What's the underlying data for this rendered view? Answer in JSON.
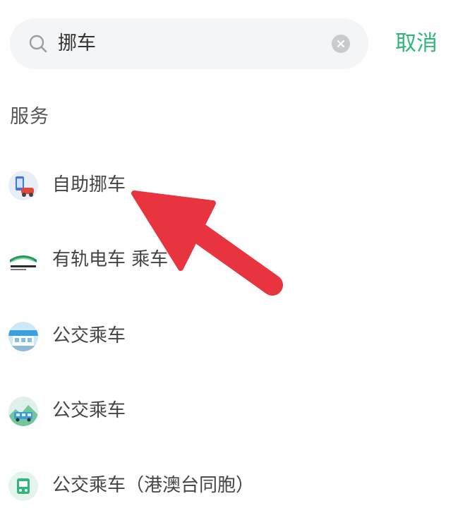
{
  "search": {
    "query": "挪车",
    "icon": "search-icon",
    "clear_icon": "clear-icon"
  },
  "cancel_label": "取消",
  "colors": {
    "accent": "#2fb67a",
    "arrow": "#e8343f",
    "search_bg": "#f4f5f7"
  },
  "section": {
    "title": "服务"
  },
  "services": [
    {
      "label": "自助挪车",
      "icon": "self-service-move-car-icon"
    },
    {
      "label": "有轨电车 乘车",
      "icon": "tram-icon"
    },
    {
      "label": "公交乘车",
      "icon": "bus-icon"
    },
    {
      "label": "公交乘车",
      "icon": "bus-scenery-icon"
    },
    {
      "label": "公交乘车（港澳台同胞）",
      "icon": "bus-card-icon"
    }
  ]
}
